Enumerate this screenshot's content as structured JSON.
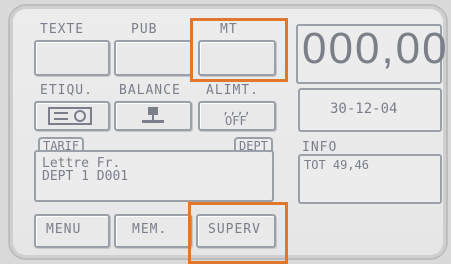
{
  "top_row": {
    "texte": "TEXTE",
    "pub": "PUB",
    "mt": "MT"
  },
  "display": {
    "amount": "000,00",
    "date": "30-12-04"
  },
  "mid_row": {
    "etiqu": "ETIQU.",
    "balance": "BALANCE",
    "alimt": "ALIMT.",
    "alimt_dots": ",,,,",
    "alimt_state": "OFF"
  },
  "tarif_panel": {
    "tab_tarif": "TARIF",
    "tab_dept": "DEPT",
    "line1": "Lettre Fr.",
    "line2": "DEPT 1 D001"
  },
  "info_panel": {
    "label": "INFO",
    "text": "TOT 49,46"
  },
  "bottom_row": {
    "menu": "MENU",
    "mem": "MEM.",
    "superv": "SUPERV"
  },
  "colors": {
    "highlight": "#e0772c",
    "background": "#ececec",
    "border": "#9aa0aa"
  }
}
